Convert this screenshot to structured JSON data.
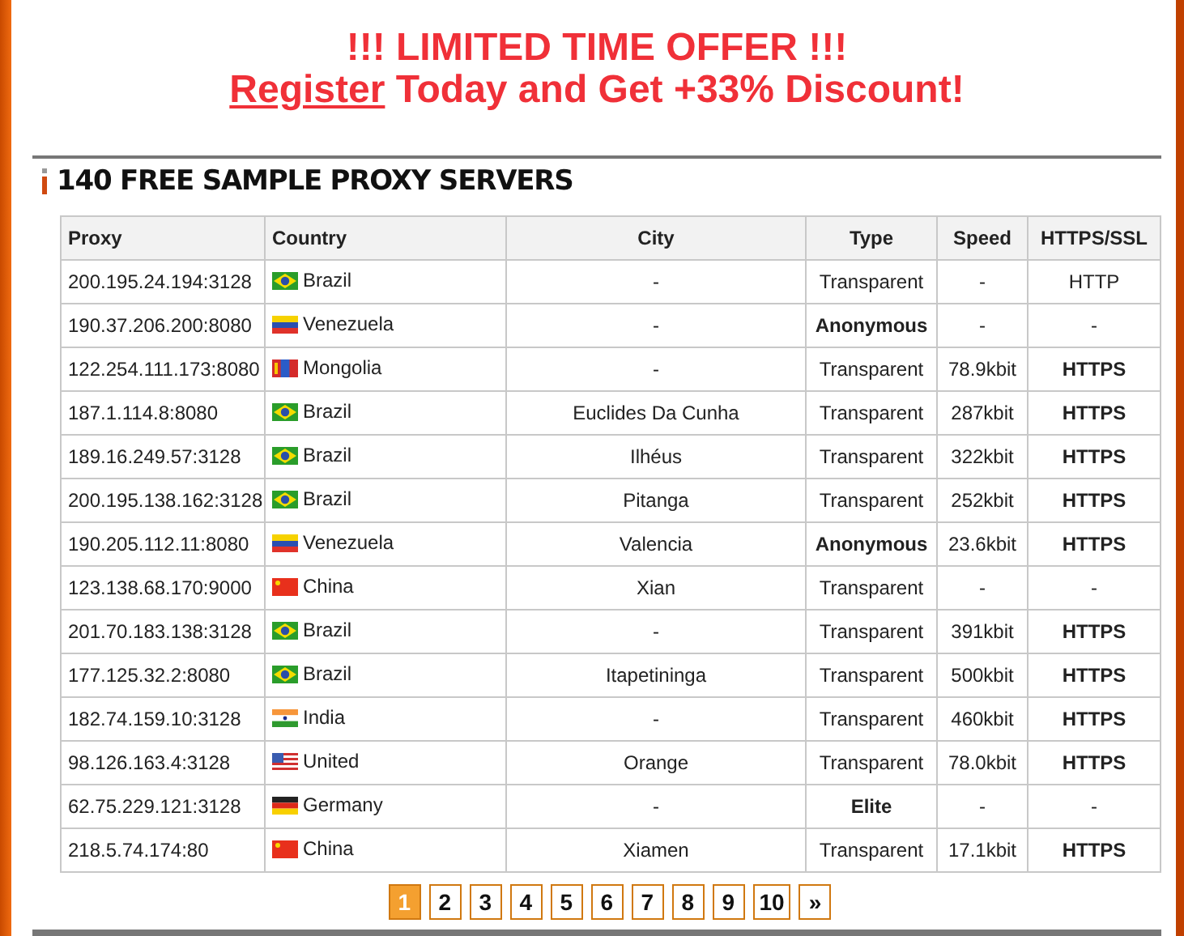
{
  "banner": {
    "headline": "!!! LIMITED TIME OFFER !!!",
    "link": "Register",
    "rest": " Today and Get +33% Discount!"
  },
  "section": {
    "title": "140 FREE SAMPLE PROXY SERVERS"
  },
  "table": {
    "columns": [
      "Proxy",
      "Country",
      "City",
      "Type",
      "Speed",
      "HTTPS/SSL"
    ],
    "rows": [
      {
        "proxy": "200.195.24.194:3128",
        "flag": {
          "kind": "br"
        },
        "country": "Brazil",
        "city": "-",
        "type": "Transparent",
        "type_strong": false,
        "speed": "-",
        "ssl": "HTTP",
        "ssl_strong": false
      },
      {
        "proxy": "190.37.206.200:8080",
        "flag": {
          "kind": "ve"
        },
        "country": "Venezuela",
        "city": "-",
        "type": "Anonymous",
        "type_strong": true,
        "speed": "-",
        "ssl": "-",
        "ssl_strong": false
      },
      {
        "proxy": "122.254.111.173:8080",
        "flag": {
          "kind": "mn"
        },
        "country": "Mongolia",
        "city": "-",
        "type": "Transparent",
        "type_strong": false,
        "speed": "78.9kbit",
        "ssl": "HTTPS",
        "ssl_strong": true
      },
      {
        "proxy": "187.1.114.8:8080",
        "flag": {
          "kind": "br"
        },
        "country": "Brazil",
        "city": "Euclides Da Cunha",
        "type": "Transparent",
        "type_strong": false,
        "speed": "287kbit",
        "ssl": "HTTPS",
        "ssl_strong": true
      },
      {
        "proxy": "189.16.249.57:3128",
        "flag": {
          "kind": "br"
        },
        "country": "Brazil",
        "city": "Ilhéus",
        "type": "Transparent",
        "type_strong": false,
        "speed": "322kbit",
        "ssl": "HTTPS",
        "ssl_strong": true
      },
      {
        "proxy": "200.195.138.162:3128",
        "flag": {
          "kind": "br"
        },
        "country": "Brazil",
        "city": "Pitanga",
        "type": "Transparent",
        "type_strong": false,
        "speed": "252kbit",
        "ssl": "HTTPS",
        "ssl_strong": true
      },
      {
        "proxy": "190.205.112.11:8080",
        "flag": {
          "kind": "ve"
        },
        "country": "Venezuela",
        "city": "Valencia",
        "type": "Anonymous",
        "type_strong": true,
        "speed": "23.6kbit",
        "ssl": "HTTPS",
        "ssl_strong": true
      },
      {
        "proxy": "123.138.68.170:9000",
        "flag": {
          "kind": "cn"
        },
        "country": "China",
        "city": "Xian",
        "type": "Transparent",
        "type_strong": false,
        "speed": "-",
        "ssl": "-",
        "ssl_strong": false
      },
      {
        "proxy": "201.70.183.138:3128",
        "flag": {
          "kind": "br"
        },
        "country": "Brazil",
        "city": "-",
        "type": "Transparent",
        "type_strong": false,
        "speed": "391kbit",
        "ssl": "HTTPS",
        "ssl_strong": true
      },
      {
        "proxy": "177.125.32.2:8080",
        "flag": {
          "kind": "br"
        },
        "country": "Brazil",
        "city": "Itapetininga",
        "type": "Transparent",
        "type_strong": false,
        "speed": "500kbit",
        "ssl": "HTTPS",
        "ssl_strong": true
      },
      {
        "proxy": "182.74.159.10:3128",
        "flag": {
          "kind": "in"
        },
        "country": "India",
        "city": "-",
        "type": "Transparent",
        "type_strong": false,
        "speed": "460kbit",
        "ssl": "HTTPS",
        "ssl_strong": true
      },
      {
        "proxy": "98.126.163.4:3128",
        "flag": {
          "kind": "us"
        },
        "country": "United",
        "city": "Orange",
        "type": "Transparent",
        "type_strong": false,
        "speed": "78.0kbit",
        "ssl": "HTTPS",
        "ssl_strong": true
      },
      {
        "proxy": "62.75.229.121:3128",
        "flag": {
          "kind": "de"
        },
        "country": "Germany",
        "city": "-",
        "type": "Elite",
        "type_strong": true,
        "speed": "-",
        "ssl": "-",
        "ssl_strong": false
      },
      {
        "proxy": "218.5.74.174:80",
        "flag": {
          "kind": "cn"
        },
        "country": "China",
        "city": "Xiamen",
        "type": "Transparent",
        "type_strong": false,
        "speed": "17.1kbit",
        "ssl": "HTTPS",
        "ssl_strong": true
      }
    ]
  },
  "pagination": [
    {
      "label": "1",
      "selected": true
    },
    {
      "label": "2",
      "selected": false
    },
    {
      "label": "3",
      "selected": false
    },
    {
      "label": "4",
      "selected": false
    },
    {
      "label": "5",
      "selected": false
    },
    {
      "label": "6",
      "selected": false
    },
    {
      "label": "7",
      "selected": false
    },
    {
      "label": "8",
      "selected": false
    },
    {
      "label": "9",
      "selected": false
    },
    {
      "label": "10",
      "selected": false
    },
    {
      "label": "»",
      "selected": false
    }
  ]
}
